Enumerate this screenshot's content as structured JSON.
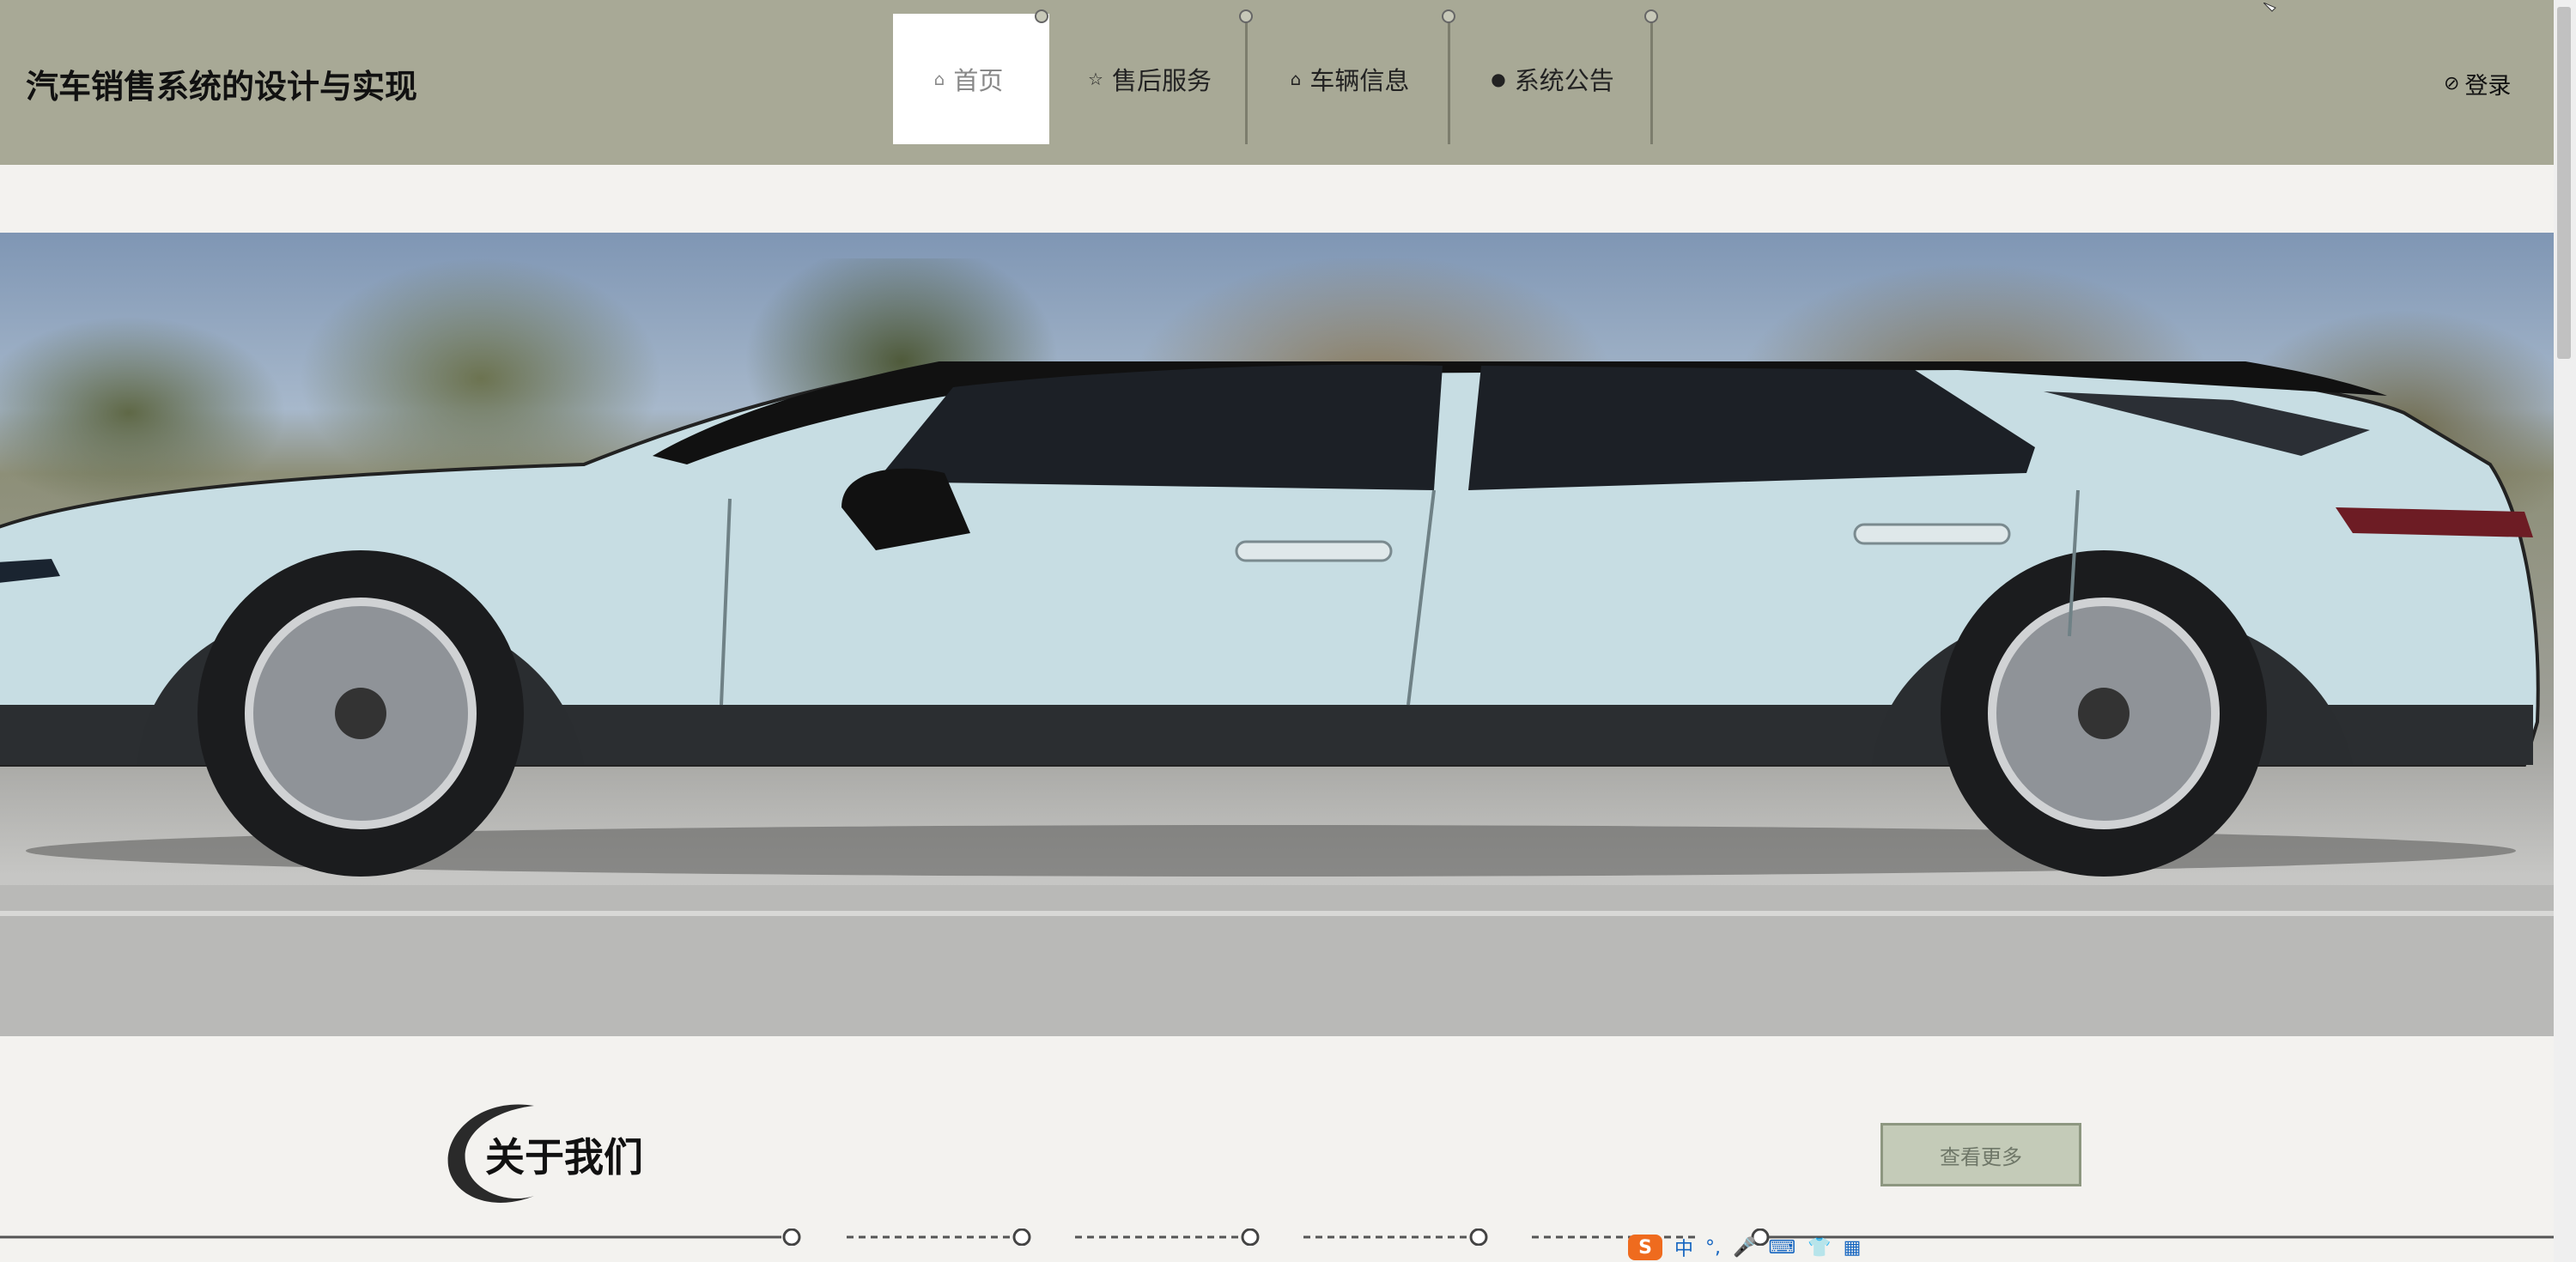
{
  "header": {
    "site_title": "汽车销售系统的设计与实现",
    "nav": [
      {
        "label": "首页",
        "icon": "home-icon",
        "active": true
      },
      {
        "label": "售后服务",
        "icon": "star-icon",
        "active": false
      },
      {
        "label": "车辆信息",
        "icon": "lock-icon",
        "active": false
      },
      {
        "label": "系统公告",
        "icon": "alert-icon",
        "active": false
      }
    ],
    "login_label": "登录",
    "login_icon": "check-circle-icon"
  },
  "banner": {
    "slide_count": 3,
    "active_slide": 1
  },
  "about": {
    "title": "关于我们",
    "more_label": "查看更多"
  },
  "ime": {
    "logo": "S",
    "mode": "中",
    "punct": "°,"
  },
  "colors": {
    "header_bg": "#a8a996",
    "page_bg": "#f3f2ef",
    "button_bg": "#c4cbb8",
    "car_color": "#c6dde3"
  }
}
